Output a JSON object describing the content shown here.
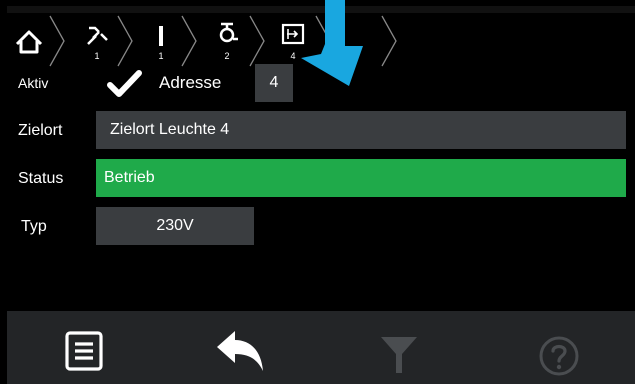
{
  "breadcrumb": {
    "items": [
      {
        "icon": "home-icon",
        "number": ""
      },
      {
        "icon": "cut-wire-icon",
        "number": "1"
      },
      {
        "icon": "line-icon",
        "number": "1"
      },
      {
        "icon": "lamp-icon",
        "number": "2"
      },
      {
        "icon": "exit-sign-icon",
        "number": "4"
      }
    ]
  },
  "row_aktiv": {
    "label": "Aktiv",
    "address_label": "Adresse",
    "address_value": "4"
  },
  "row_zielort": {
    "label": "Zielort",
    "value": "Zielort Leuchte 4"
  },
  "row_status": {
    "label": "Status",
    "value": "Betrieb"
  },
  "row_typ": {
    "label": "Typ",
    "value": "230V"
  },
  "bottom_bar": {
    "icons": [
      "menu-list-icon",
      "back-icon",
      "filter-icon",
      "help-icon"
    ]
  },
  "colors": {
    "background": "#000000",
    "field": "#3a3d40",
    "status_ok": "#1faa4a",
    "bottom_bar": "#232527",
    "arrow": "#19a7e0",
    "disabled_icon": "#4a4d50"
  }
}
